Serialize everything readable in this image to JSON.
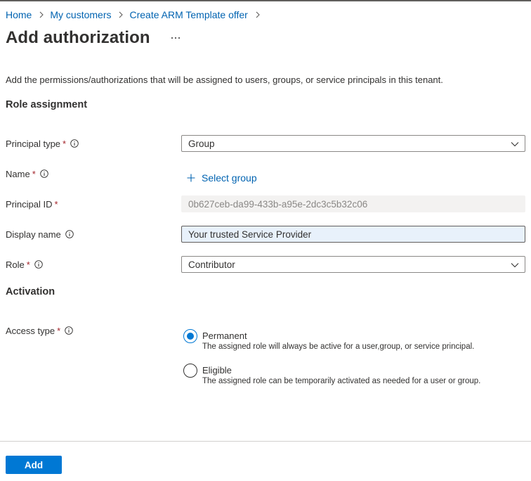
{
  "breadcrumb": {
    "items": [
      "Home",
      "My customers",
      "Create ARM Template offer"
    ]
  },
  "page": {
    "title": "Add authorization",
    "more_label": "...",
    "description": "Add the permissions/authorizations that will be assigned to users, groups, or service principals in this tenant."
  },
  "role_assignment": {
    "heading": "Role assignment",
    "principal_type": {
      "label": "Principal type",
      "required_mark": "*",
      "value": "Group"
    },
    "name": {
      "label": "Name",
      "required_mark": "*",
      "action": "Select group"
    },
    "principal_id": {
      "label": "Principal ID",
      "required_mark": "*",
      "value": "0b627ceb-da99-433b-a95e-2dc3c5b32c06"
    },
    "display_name": {
      "label": "Display name",
      "value": "Your trusted Service Provider"
    },
    "role": {
      "label": "Role",
      "required_mark": "*",
      "value": "Contributor"
    }
  },
  "activation": {
    "heading": "Activation",
    "access_type": {
      "label": "Access type",
      "required_mark": "*"
    },
    "options": [
      {
        "label": "Permanent",
        "description": "The assigned role will always be active for a user,group, or service principal.",
        "selected": true
      },
      {
        "label": "Eligible",
        "description": "The assigned role can be temporarily activated as needed for a user or group.",
        "selected": false
      }
    ]
  },
  "footer": {
    "add_label": "Add"
  },
  "colors": {
    "accent": "#0078d4",
    "link": "#0063b1",
    "required": "#a4262c",
    "text": "#323130"
  },
  "icons": [
    "chevron-right-icon",
    "more-icon",
    "info-icon",
    "chevron-down-icon",
    "plus-icon"
  ]
}
